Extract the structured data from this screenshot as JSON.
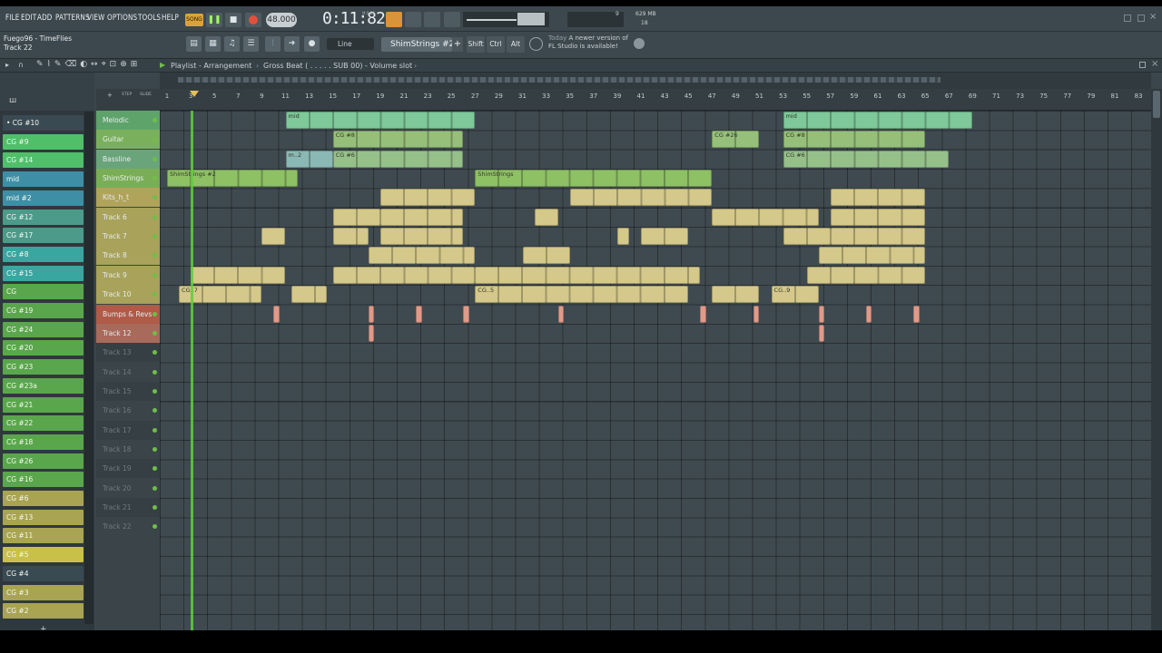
{
  "menu": [
    "FILE",
    "EDIT",
    "ADD",
    "PATTERNS",
    "VIEW",
    "OPTIONS",
    "TOOLS",
    "HELP"
  ],
  "transport": {
    "mode": "SONG",
    "tempo": "48.000",
    "time": "0:11:82",
    "time_label": "M:S:CS"
  },
  "monitor": {
    "value1": "9",
    "mem": "629 MB",
    "value2": "18"
  },
  "hint": {
    "project": "Fuego96 - TimeFlies",
    "track": "Track 22"
  },
  "toolbar2": {
    "snap": "Line",
    "pattern": "ShimStrings #2",
    "shift": "Shift",
    "ctrl": "Ctrl",
    "alt": "Alt",
    "news_date": "Today",
    "news_text": "A newer version of FL Studio is available!"
  },
  "playlist": {
    "breadcrumb": "Playlist - Arrangement",
    "breadcrumb_sep": "›",
    "slot": "Gross Beat ( . . . . . SUB 00) - Volume slot",
    "slot_sep": "›",
    "step_label": "STEP",
    "slide_label": "SLIDE",
    "marker": "5"
  },
  "ruler": [
    "1",
    "3",
    "5",
    "7",
    "9",
    "11",
    "13",
    "15",
    "17",
    "19",
    "21",
    "23",
    "25",
    "27",
    "29",
    "31",
    "33",
    "35",
    "37",
    "39",
    "41",
    "43",
    "45",
    "47",
    "49",
    "51",
    "53",
    "55",
    "57",
    "59",
    "61",
    "63",
    "65",
    "67",
    "69",
    "71",
    "73",
    "75",
    "77",
    "79",
    "81",
    "83"
  ],
  "channels": [
    {
      "label": "• CG #10",
      "color": "#3a4a52"
    },
    {
      "label": "CG #9",
      "color": "#4fbf6a"
    },
    {
      "label": "CG #14",
      "color": "#4fbf6a"
    },
    {
      "label": "mid",
      "color": "#3e8fa6"
    },
    {
      "label": "mid #2",
      "color": "#3e8fa6"
    },
    {
      "label": "CG #12",
      "color": "#4c9a8a"
    },
    {
      "label": "CG #17",
      "color": "#4c9a8a"
    },
    {
      "label": "CG #8",
      "color": "#3aa6a0"
    },
    {
      "label": "CG #15",
      "color": "#3aa6a0"
    },
    {
      "label": "CG",
      "color": "#5aa64c"
    },
    {
      "label": "CG #19",
      "color": "#5aa64c"
    },
    {
      "label": "CG #24",
      "color": "#5aa64c"
    },
    {
      "label": "CG #20",
      "color": "#5aa64c"
    },
    {
      "label": "CG #23",
      "color": "#5aa64c"
    },
    {
      "label": "CG #23a",
      "color": "#5aa64c"
    },
    {
      "label": "CG #21",
      "color": "#5aa64c"
    },
    {
      "label": "CG #22",
      "color": "#5aa64c"
    },
    {
      "label": "CG #18",
      "color": "#5aa64c"
    },
    {
      "label": "CG #26",
      "color": "#5aa64c"
    },
    {
      "label": "CG #16",
      "color": "#5aa64c"
    },
    {
      "label": "CG #6",
      "color": "#a8a452"
    },
    {
      "label": "CG #13",
      "color": "#a8a452"
    },
    {
      "label": "CG #11",
      "color": "#a8a452"
    },
    {
      "label": "CG #5",
      "color": "#c9c04a"
    },
    {
      "label": "CG #4",
      "color": "#3a4a52"
    },
    {
      "label": "CG #3",
      "color": "#a8a452"
    },
    {
      "label": "CG #2",
      "color": "#a8a452"
    }
  ],
  "tracks": [
    {
      "label": "Melodic",
      "bg": "#5ea36a",
      "empty": false
    },
    {
      "label": "Guitar",
      "bg": "#7ab05c",
      "empty": false
    },
    {
      "label": "Bassline",
      "bg": "#6aa47a",
      "empty": false
    },
    {
      "label": "ShimStrings",
      "bg": "#7aae56",
      "empty": false
    },
    {
      "label": "Kits_h_t",
      "bg": "#b0a45a",
      "empty": false
    },
    {
      "label": "Track 6",
      "bg": "#a8a25a",
      "empty": false
    },
    {
      "label": "Track 7",
      "bg": "#a8a25a",
      "empty": false
    },
    {
      "label": "Track 8",
      "bg": "#a8a25a",
      "empty": false
    },
    {
      "label": "Track 9",
      "bg": "#a8a25a",
      "empty": false
    },
    {
      "label": "Track 10",
      "bg": "#a8a25a",
      "empty": false
    },
    {
      "label": "Bumps & Revs",
      "bg": "#b05a48",
      "empty": false
    },
    {
      "label": "Track 12",
      "bg": "#a86a5a",
      "empty": false
    },
    {
      "label": "Track 13",
      "bg": "#3a4449",
      "empty": true
    },
    {
      "label": "Track 14",
      "bg": "#3a4449",
      "empty": true
    },
    {
      "label": "Track 15",
      "bg": "#3a4449",
      "empty": true
    },
    {
      "label": "Track 16",
      "bg": "#3a4449",
      "empty": true
    },
    {
      "label": "Track 17",
      "bg": "#3a4449",
      "empty": true
    },
    {
      "label": "Track 18",
      "bg": "#3a4449",
      "empty": true
    },
    {
      "label": "Track 19",
      "bg": "#3a4449",
      "empty": true
    },
    {
      "label": "Track 20",
      "bg": "#3a4449",
      "empty": true
    },
    {
      "label": "Track 21",
      "bg": "#3a4449",
      "empty": true
    },
    {
      "label": "Track 22",
      "bg": "#3a4449",
      "empty": true
    }
  ],
  "clips": [
    {
      "track": 0,
      "bar": 11.0,
      "len": 16,
      "label": "mid",
      "color": "#7ec89a"
    },
    {
      "track": 0,
      "bar": 53.0,
      "len": 16,
      "label": "mid",
      "color": "#7ec89a"
    },
    {
      "track": 1,
      "bar": 15.0,
      "len": 11,
      "label": "CG #8",
      "color": "#96c07a"
    },
    {
      "track": 1,
      "bar": 47.0,
      "len": 4,
      "label": "CG #26",
      "color": "#96c07a"
    },
    {
      "track": 1,
      "bar": 53.0,
      "len": 12,
      "label": "CG #8",
      "color": "#96c07a"
    },
    {
      "track": 2,
      "bar": 11.0,
      "len": 4,
      "label": "m..2",
      "color": "#8ab8b4"
    },
    {
      "track": 2,
      "bar": 15.0,
      "len": 11,
      "label": "CG #6",
      "color": "#96c08a"
    },
    {
      "track": 2,
      "bar": 53.0,
      "len": 14,
      "label": "CG #6",
      "color": "#96c08a"
    },
    {
      "track": 3,
      "bar": 1.0,
      "len": 11,
      "label": "ShimStrings #2",
      "color": "#8ec064"
    },
    {
      "track": 3,
      "bar": 27.0,
      "len": 20,
      "label": "ShimStrings",
      "color": "#8ec064"
    },
    {
      "track": 4,
      "bar": 19.0,
      "len": 8,
      "label": "",
      "color": "#d4c88a"
    },
    {
      "track": 4,
      "bar": 35.0,
      "len": 12,
      "label": "",
      "color": "#d4c88a"
    },
    {
      "track": 4,
      "bar": 57.0,
      "len": 8,
      "label": "",
      "color": "#d4c88a"
    },
    {
      "track": 5,
      "bar": 15.0,
      "len": 4,
      "label": "",
      "color": "#d4c88a"
    },
    {
      "track": 5,
      "bar": 19.0,
      "len": 7,
      "label": "",
      "color": "#d4c88a"
    },
    {
      "track": 5,
      "bar": 32.0,
      "len": 2,
      "label": "",
      "color": "#d4c88a"
    },
    {
      "track": 5,
      "bar": 47.0,
      "len": 9,
      "label": "",
      "color": "#d4c88a"
    },
    {
      "track": 5,
      "bar": 57.0,
      "len": 8,
      "label": "",
      "color": "#d4c88a"
    },
    {
      "track": 6,
      "bar": 9.0,
      "len": 2,
      "label": "",
      "color": "#d4c88a"
    },
    {
      "track": 6,
      "bar": 15.0,
      "len": 3,
      "label": "",
      "color": "#d4c88a"
    },
    {
      "track": 6,
      "bar": 19.0,
      "len": 7,
      "label": "",
      "color": "#d4c88a"
    },
    {
      "track": 6,
      "bar": 39.0,
      "len": 1,
      "label": "",
      "color": "#d4c88a"
    },
    {
      "track": 6,
      "bar": 41.0,
      "len": 4,
      "label": "",
      "color": "#d4c88a"
    },
    {
      "track": 6,
      "bar": 53.0,
      "len": 4,
      "label": "",
      "color": "#d4c88a"
    },
    {
      "track": 6,
      "bar": 57.0,
      "len": 8,
      "label": "",
      "color": "#d4c88a"
    },
    {
      "track": 7,
      "bar": 18.0,
      "len": 9,
      "label": "",
      "color": "#d4c88a"
    },
    {
      "track": 7,
      "bar": 31.0,
      "len": 4,
      "label": "",
      "color": "#d4c88a"
    },
    {
      "track": 7,
      "bar": 56.0,
      "len": 9,
      "label": "",
      "color": "#d4c88a"
    },
    {
      "track": 8,
      "bar": 3.0,
      "len": 8,
      "label": "",
      "color": "#d4c88a"
    },
    {
      "track": 8,
      "bar": 15.0,
      "len": 12,
      "label": "",
      "color": "#d4c88a"
    },
    {
      "track": 8,
      "bar": 27.0,
      "len": 19,
      "label": "",
      "color": "#d4c88a"
    },
    {
      "track": 8,
      "bar": 55.0,
      "len": 10,
      "label": "",
      "color": "#d4c88a"
    },
    {
      "track": 9,
      "bar": 2.0,
      "len": 7,
      "label": "CG..7",
      "color": "#d4c88a"
    },
    {
      "track": 9,
      "bar": 11.5,
      "len": 3,
      "label": "",
      "color": "#d4c88a"
    },
    {
      "track": 9,
      "bar": 27.0,
      "len": 18,
      "label": "CG..5",
      "color": "#d4c88a"
    },
    {
      "track": 9,
      "bar": 47.0,
      "len": 4,
      "label": "",
      "color": "#d4c88a"
    },
    {
      "track": 9,
      "bar": 52.0,
      "len": 4,
      "label": "CG..9",
      "color": "#d4c88a"
    },
    {
      "track": 10,
      "bar": 10.0,
      "len": 0.5,
      "label": "",
      "color": "#e09a8a"
    },
    {
      "track": 10,
      "bar": 18.0,
      "len": 0.5,
      "label": "",
      "color": "#e09a8a"
    },
    {
      "track": 10,
      "bar": 22.0,
      "len": 0.5,
      "label": "",
      "color": "#e09a8a"
    },
    {
      "track": 10,
      "bar": 26.0,
      "len": 0.5,
      "label": "",
      "color": "#e09a8a"
    },
    {
      "track": 10,
      "bar": 34.0,
      "len": 0.5,
      "label": "",
      "color": "#e09a8a"
    },
    {
      "track": 10,
      "bar": 46.0,
      "len": 0.5,
      "label": "",
      "color": "#e09a8a"
    },
    {
      "track": 10,
      "bar": 50.5,
      "len": 0.5,
      "label": "",
      "color": "#e09a8a"
    },
    {
      "track": 10,
      "bar": 56.0,
      "len": 0.5,
      "label": "",
      "color": "#e09a8a"
    },
    {
      "track": 10,
      "bar": 60.0,
      "len": 0.5,
      "label": "",
      "color": "#e09a8a"
    },
    {
      "track": 10,
      "bar": 64.0,
      "len": 0.5,
      "label": "",
      "color": "#e09a8a"
    },
    {
      "track": 11,
      "bar": 18.0,
      "len": 0.5,
      "label": "",
      "color": "#e09a8a"
    },
    {
      "track": 11,
      "bar": 56.0,
      "len": 0.5,
      "label": "",
      "color": "#e09a8a"
    }
  ]
}
